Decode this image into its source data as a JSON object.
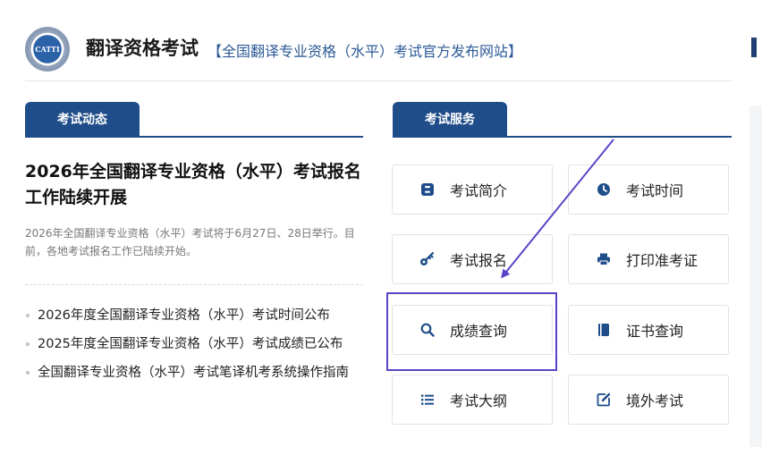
{
  "header": {
    "logo_text": "CATTI",
    "title": "翻译资格考试",
    "subtitle": "【全国翻译专业资格（水平）考试官方发布网站】"
  },
  "news": {
    "tab_label": "考试动态",
    "headline": "2026年全国翻译专业资格（水平）考试报名工作陆续开展",
    "summary": "2026年全国翻译专业资格（水平）考试将于6月27日、28日举行。目前，各地考试报名工作已陆续开始。",
    "items": [
      "2026年度全国翻译专业资格（水平）考试时间公布",
      "2025年度全国翻译专业资格（水平）考试成绩已公布",
      "全国翻译专业资格（水平）考试笔译机考系统操作指南"
    ]
  },
  "services": {
    "tab_label": "考试服务",
    "items": [
      {
        "label": "考试简介",
        "icon": "bold-b-icon"
      },
      {
        "label": "考试时间",
        "icon": "clock-icon"
      },
      {
        "label": "考试报名",
        "icon": "key-icon"
      },
      {
        "label": "打印准考证",
        "icon": "printer-icon"
      },
      {
        "label": "成绩查询",
        "icon": "search-icon"
      },
      {
        "label": "证书查询",
        "icon": "book-icon"
      },
      {
        "label": "考试大纲",
        "icon": "list-icon"
      },
      {
        "label": "境外考试",
        "icon": "edit-icon"
      }
    ]
  },
  "colors": {
    "primary": "#1f4d8a",
    "annotation": "#5b43c7"
  }
}
